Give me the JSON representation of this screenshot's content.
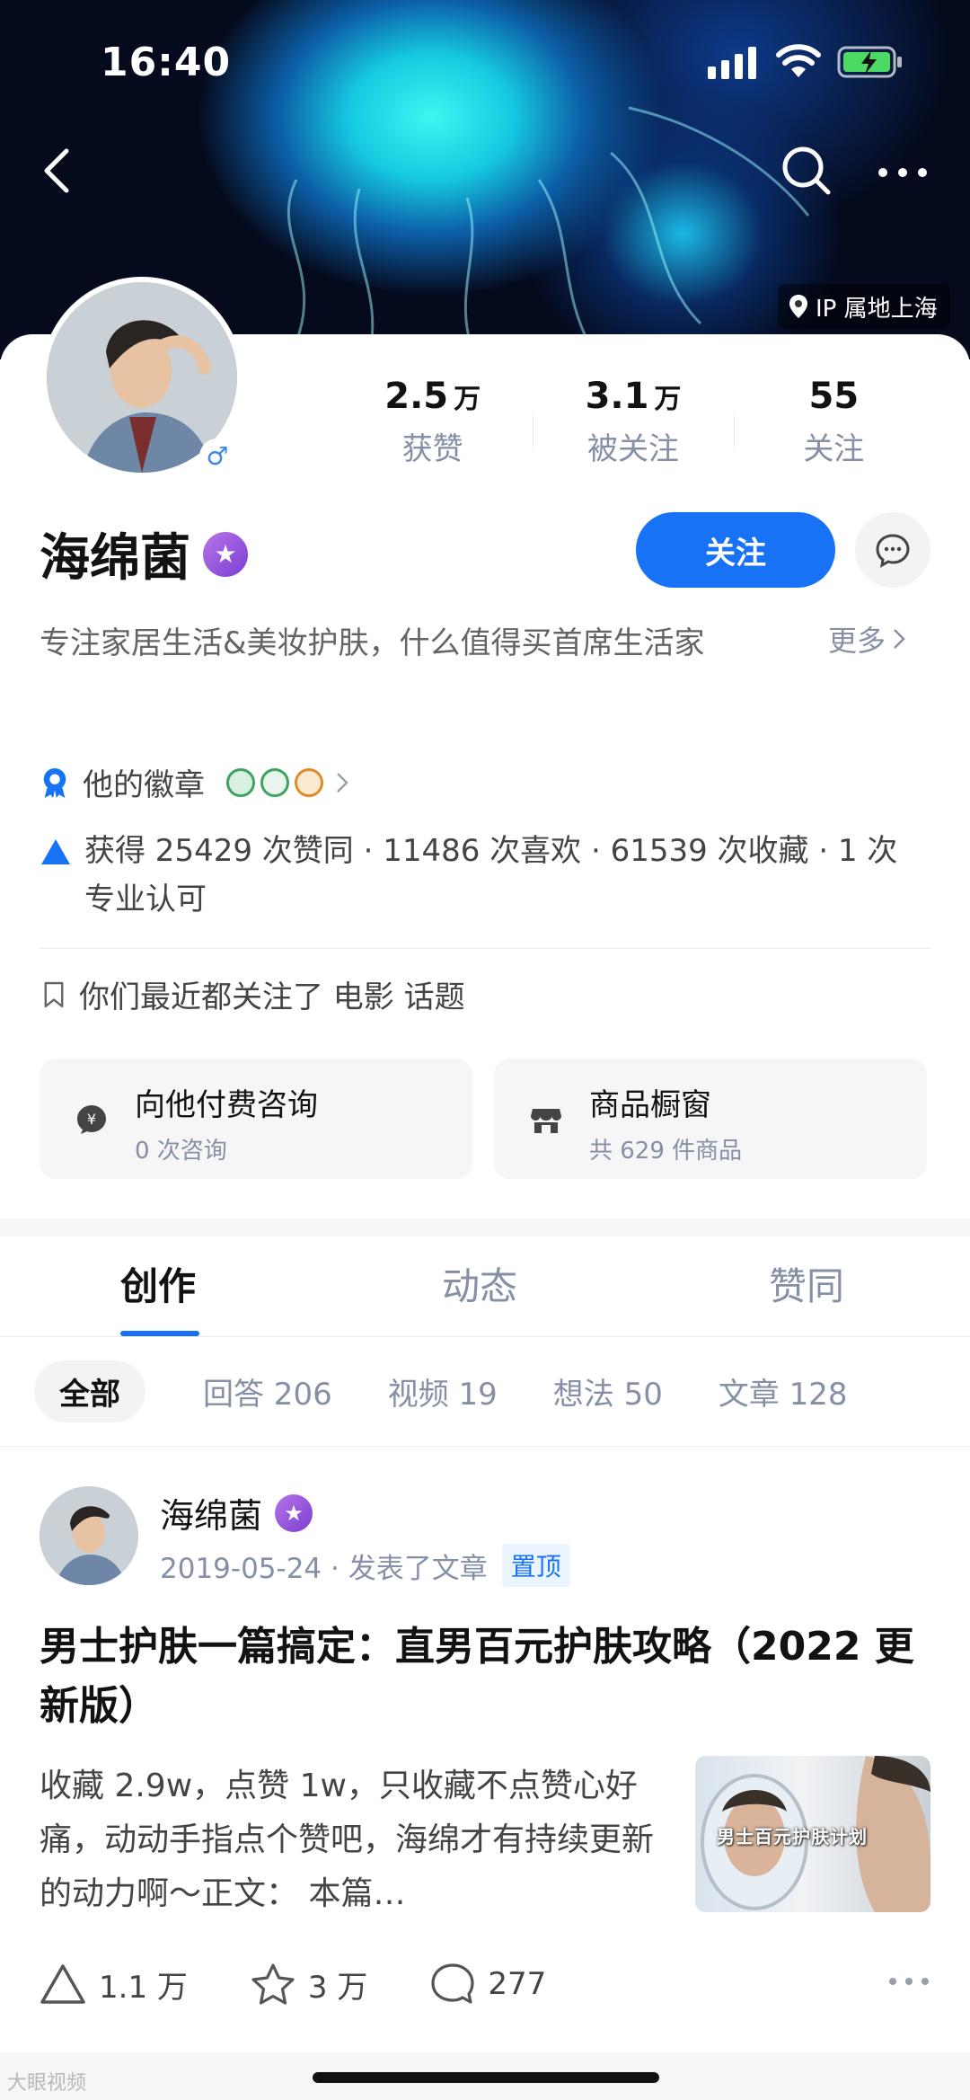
{
  "status_bar": {
    "time": "16:40"
  },
  "header": {
    "ip_location": "IP 属地上海"
  },
  "profile": {
    "name": "海绵菌",
    "gender_symbol": "♂",
    "follow_label": "关注",
    "bio": "专注家居生活&美妆护肤，什么值得买首席生活家",
    "bio_more": "更多",
    "stats": [
      {
        "num": "2.5",
        "unit": "万",
        "label": "获赞"
      },
      {
        "num": "3.1",
        "unit": "万",
        "label": "被关注"
      },
      {
        "num": "55",
        "unit": "",
        "label": "关注"
      }
    ],
    "badges_label": "他的徽章",
    "achievements": "获得 25429 次赞同 · 11486 次喜欢 · 61539 次收藏 · 1 次专业认可",
    "mutual_follow": "你们最近都关注了 电影 话题",
    "services": [
      {
        "title": "向他付费咨询",
        "sub": "0 次咨询"
      },
      {
        "title": "商品橱窗",
        "sub": "共 629 件商品"
      }
    ]
  },
  "tabs": [
    "创作",
    "动态",
    "赞同"
  ],
  "subtabs": [
    "全部",
    "回答 206",
    "视频 19",
    "想法 50",
    "文章 128"
  ],
  "feed_item": {
    "author": "海绵菌",
    "date": "2019-05-24 · 发表了文章",
    "pin_label": "置顶",
    "title": "男士护肤一篇搞定：直男百元护肤攻略（2022 更新版）",
    "excerpt": "收藏 2.9w，点赞 1w，只收藏不点赞心好痛，动动手指点个赞吧，海绵才有持续更新的动力啊～正文： 本篇…",
    "thumb_text": "男士百元护肤计划",
    "actions": {
      "upvotes": "1.1 万",
      "favorites": "3 万",
      "comments": "277"
    }
  },
  "watermark": "大眼视频",
  "colors": {
    "accent": "#1772f6",
    "verified_badge": "#8a4fdc"
  }
}
